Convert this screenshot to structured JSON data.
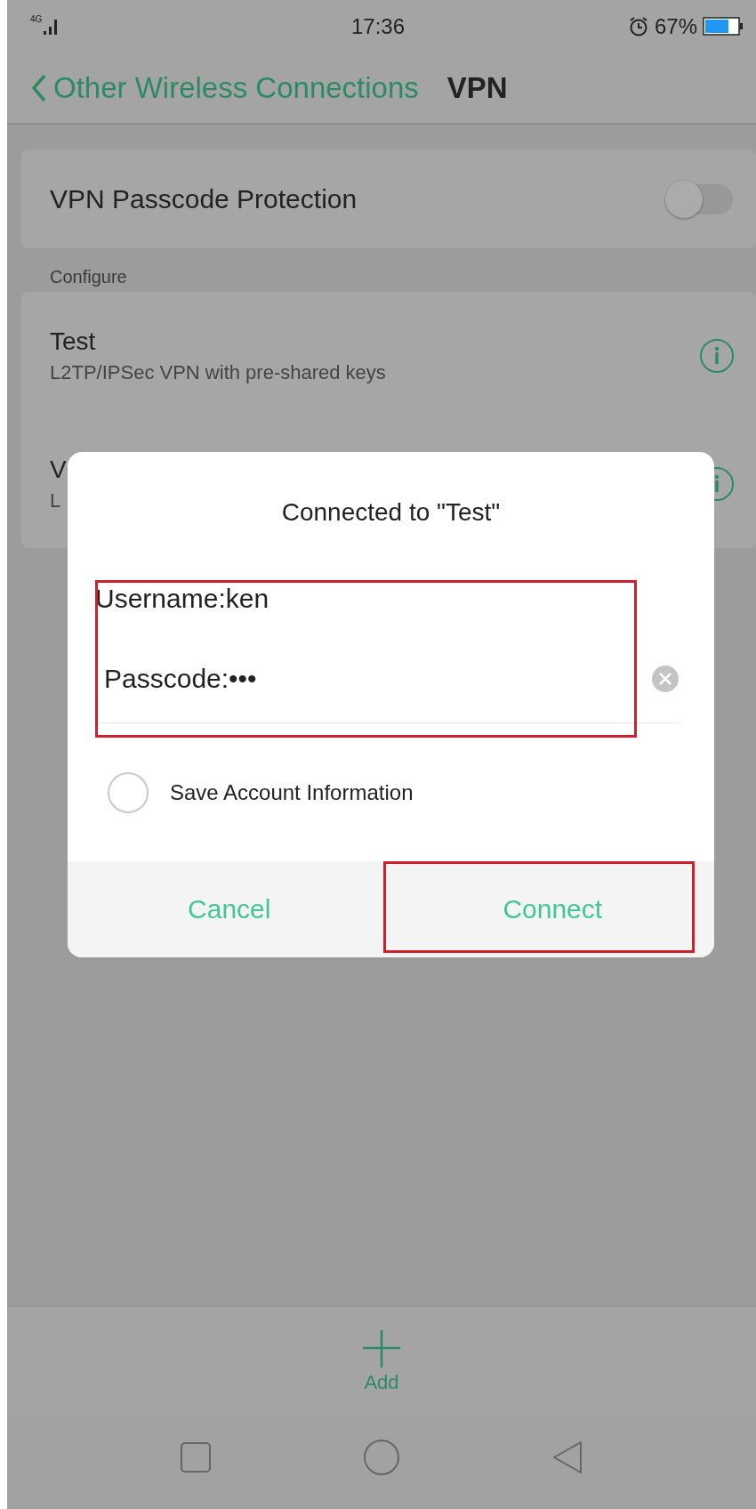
{
  "status_bar": {
    "network": "4G",
    "time": "17:36",
    "battery": "67%"
  },
  "header": {
    "back_label": "Other Wireless Connections",
    "title": "VPN"
  },
  "settings": [
    {
      "label": "VPN Passcode Protection",
      "on": false
    }
  ],
  "section_label": "Configure",
  "vpn_profiles": [
    {
      "name": "Test",
      "type": "L2TP/IPSec VPN with pre-shared keys"
    },
    {
      "name": "V",
      "type": "L"
    }
  ],
  "dialog": {
    "title": "Connected to \"Test\"",
    "username": "Username:ken",
    "passcode": "Passcode:•••",
    "fields_highlighted": true,
    "save_account": {
      "label": "Save Account Information",
      "checked": false
    },
    "buttons": [
      {
        "label": "Cancel",
        "highlighted": false
      },
      {
        "label": "Connect",
        "highlighted": true
      }
    ]
  },
  "bottom_bar": {
    "add_label": "Add"
  }
}
